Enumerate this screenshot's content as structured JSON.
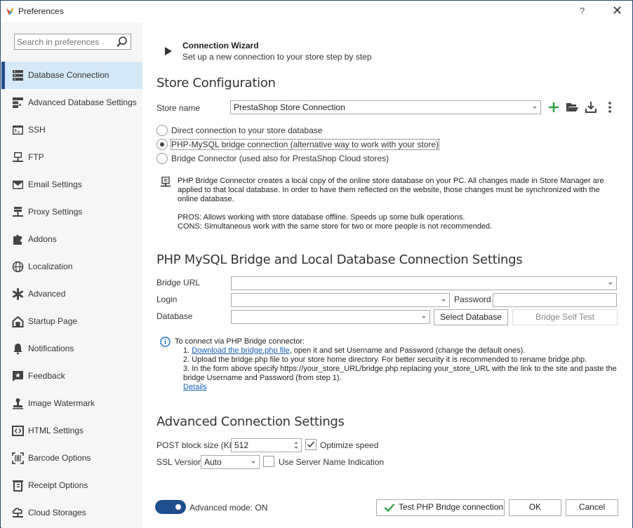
{
  "window": {
    "title": "Preferences",
    "help_label": "?",
    "close_label": "✕"
  },
  "sidebar": {
    "search_placeholder": "Search in preferences",
    "items": [
      {
        "label": "Database Connection",
        "icon": "database-icon",
        "active": true
      },
      {
        "label": "Advanced Database Settings",
        "icon": "database-settings-icon"
      },
      {
        "label": "SSH",
        "icon": "terminal-icon"
      },
      {
        "label": "FTP",
        "icon": "network-folder-icon"
      },
      {
        "label": "Email Settings",
        "icon": "envelope-icon"
      },
      {
        "label": "Proxy Settings",
        "icon": "server-network-icon"
      },
      {
        "label": "Addons",
        "icon": "puzzle-icon"
      },
      {
        "label": "Localization",
        "icon": "globe-icon"
      },
      {
        "label": "Advanced",
        "icon": "asterisk-icon"
      },
      {
        "label": "Startup Page",
        "icon": "home-icon"
      },
      {
        "label": "Notifications",
        "icon": "bell-icon"
      },
      {
        "label": "Feedback",
        "icon": "star-message-icon"
      },
      {
        "label": "Image Watermark",
        "icon": "stamp-icon"
      },
      {
        "label": "HTML Settings",
        "icon": "code-icon"
      },
      {
        "label": "Barcode Options",
        "icon": "barcode-icon"
      },
      {
        "label": "Receipt Options",
        "icon": "receipt-icon"
      },
      {
        "label": "Cloud Storages",
        "icon": "cloud-network-icon"
      }
    ]
  },
  "wizard": {
    "title": "Connection Wizard",
    "subtitle": "Set up a new connection to your store step by step"
  },
  "store_config": {
    "title": "Store Configuration",
    "store_name_label": "Store name",
    "store_name_value": "PrestaShop Store Connection",
    "radios": [
      {
        "label": "Direct connection to your store database",
        "checked": false
      },
      {
        "label": "PHP-MySQL bridge connection (alternative way to work with your store)",
        "checked": true
      },
      {
        "label": "Bridge Connector (used also for PrestaShop Cloud stores)",
        "checked": false
      }
    ],
    "info_lines": [
      "PHP Bridge Connector creates a local copy of the online store database on your PC. All changes made in Store Manager are",
      "applied to that local database. In order to have them reflected on the website, those changes must be synchronized with the",
      "online database."
    ],
    "pros": "PROS: Allows working with store database offline. Speeds up some bulk operations.",
    "cons": "CONS: Simultaneous work with the same store for two or more people is not recommended."
  },
  "bridge": {
    "title": "PHP MySQL Bridge and Local Database Connection Settings",
    "url_label": "Bridge URL",
    "url_value": "",
    "login_label": "Login",
    "login_value": "",
    "password_label": "Password",
    "password_value": "",
    "database_label": "Database",
    "database_value": "",
    "select_db_label": "Select Database",
    "self_test_label": "Bridge Self Test",
    "help_intro": "To connect via PHP Bridge connector:",
    "step1_prefix": "1. ",
    "step1_link": "Download the bridge.php file",
    "step1_rest": ", open it and set Username and Password (change the default ones).",
    "step2": "2. Upload the bridge.php file to your store home directory. For better security it is recommended to rename bridge.php.",
    "step3a": "3. In the form above specify https://your_store_URL/bridge.php replacing your_store_URL with the link to the site and paste the",
    "step3b": "bridge Username and Password (from step 1).",
    "details_link": "Details"
  },
  "advanced": {
    "title": "Advanced Connection Settings",
    "post_block_label": "POST block size (Kb)",
    "post_block_value": "512",
    "optimize_label": "Optimize speed",
    "optimize_checked": true,
    "ssl_label": "SSL Version",
    "ssl_value": "Auto",
    "sni_label": "Use Server Name Indication",
    "sni_checked": false
  },
  "footer": {
    "advanced_mode_label": "Advanced mode: ON",
    "advanced_mode_on": true,
    "test_label": "Test PHP Bridge connection",
    "ok_label": "OK",
    "cancel_label": "Cancel"
  },
  "colors": {
    "accent": "#1f4e8c",
    "active_nav_bg": "#d6e9f8",
    "add_green": "#2ea043",
    "link": "#1a5fb4"
  }
}
